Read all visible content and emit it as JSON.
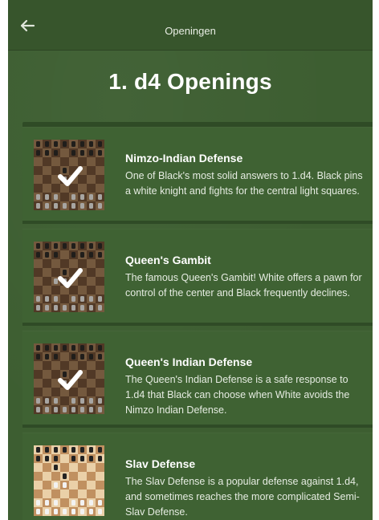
{
  "header": {
    "title": "Openingen",
    "back_icon": "arrow-left-icon"
  },
  "page_title": "1. d4 Openings",
  "colors": {
    "background": "#3d5e31",
    "card": "#3f6233",
    "card_edge": "#2f4b26",
    "board_dark": "#6e4c34",
    "board_light": "#a37d58",
    "board_dark_plain": "#c09060",
    "board_light_plain": "#ead0a8"
  },
  "openings": [
    {
      "name": "Nimzo-Indian Defense",
      "description": "One of Black's most solid answers to 1.d4. Black pins a white knight and fights for the central light squares.",
      "completed": true,
      "status_icon": "checkmark-icon"
    },
    {
      "name": "Queen's Gambit",
      "description": "The famous Queen's Gambit! White offers a pawn for control of the center and Black frequently declines.",
      "completed": true,
      "status_icon": "checkmark-icon"
    },
    {
      "name": "Queen's Indian Defense",
      "description": "The Queen's Indian Defense is a safe response to 1.d4 that Black can choose when White avoids the Nimzo Indian Defense.",
      "completed": true,
      "status_icon": "checkmark-icon"
    },
    {
      "name": "Slav Defense",
      "description": "The Slav Defense is a popular defense against 1.d4, and sometimes reaches the more complicated Semi-Slav Defense.",
      "completed": false,
      "status_icon": ""
    }
  ]
}
